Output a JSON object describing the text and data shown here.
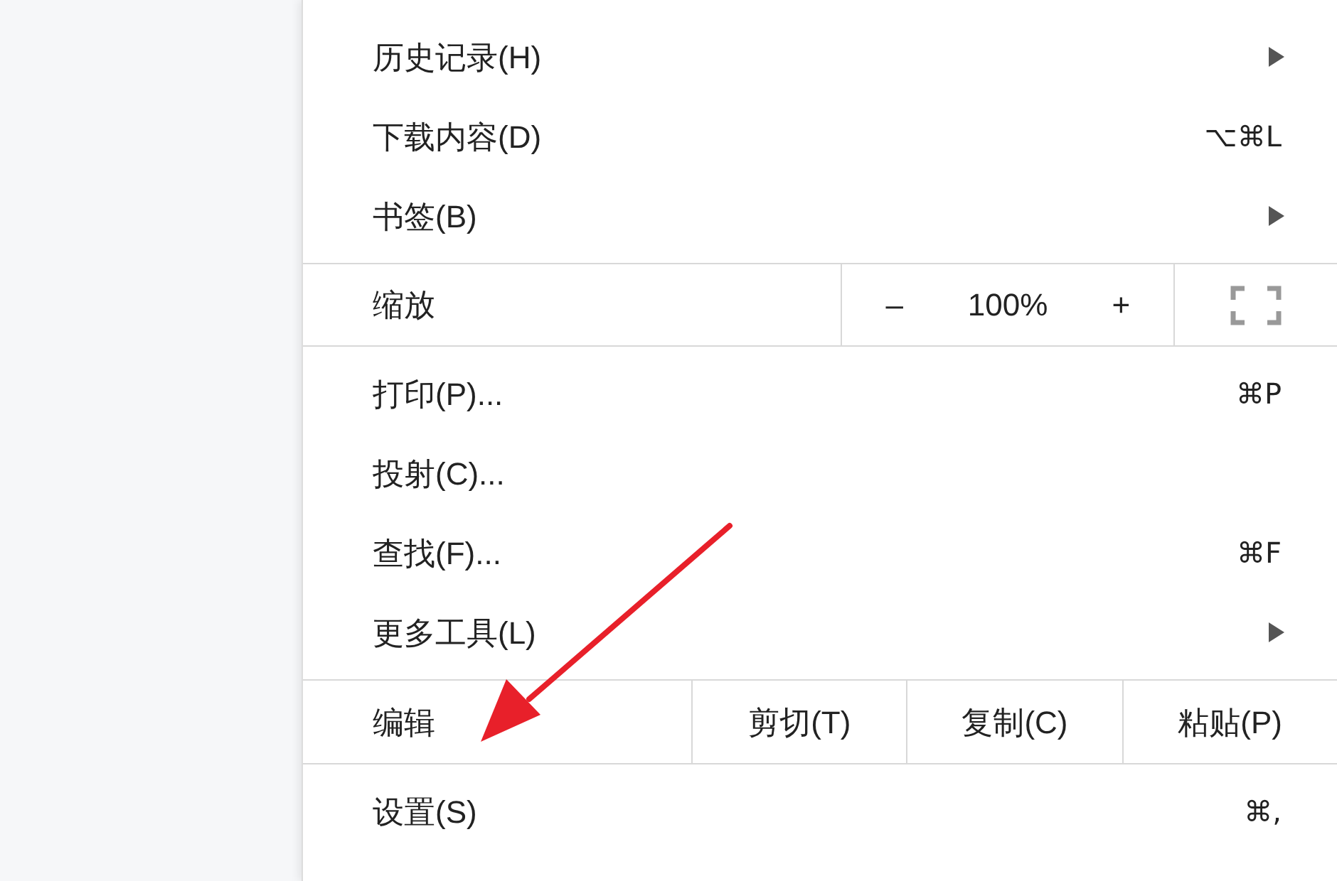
{
  "menu": {
    "sections": [
      {
        "items": [
          {
            "kind": "item",
            "label": "历史记录(H)",
            "submenu": true
          },
          {
            "kind": "item",
            "label": "下载内容(D)",
            "shortcut": "⌥⌘L",
            "submenu": false
          },
          {
            "kind": "item",
            "label": "书签(B)",
            "submenu": true
          }
        ]
      },
      {
        "items": [
          {
            "kind": "zoom",
            "label": "缩放",
            "minus": "–",
            "level_text": "100%",
            "plus": "+"
          }
        ]
      },
      {
        "items": [
          {
            "kind": "item",
            "label": "打印(P)...",
            "shortcut": "⌘P",
            "submenu": false
          },
          {
            "kind": "item",
            "label": "投射(C)...",
            "submenu": false
          },
          {
            "kind": "item",
            "label": "查找(F)...",
            "shortcut": "⌘F",
            "submenu": false
          },
          {
            "kind": "item",
            "label": "更多工具(L)",
            "submenu": true
          }
        ]
      },
      {
        "items": [
          {
            "kind": "edit",
            "label": "编辑",
            "buttons": [
              "剪切(T)",
              "复制(C)",
              "粘贴(P)"
            ]
          }
        ]
      },
      {
        "items": [
          {
            "kind": "item",
            "label": "设置(S)",
            "shortcut": "⌘,",
            "submenu": false
          }
        ]
      }
    ]
  }
}
